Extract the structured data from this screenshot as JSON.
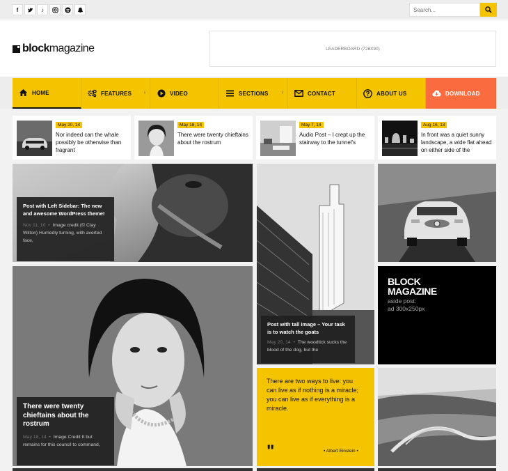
{
  "social": [
    "f",
    "t",
    "tk",
    "ig",
    "sp",
    "sc"
  ],
  "search": {
    "placeholder": "Search..."
  },
  "logo": {
    "bold": "block",
    "rest": "magazine"
  },
  "leaderboard": "LEADERBOARD (728X90)",
  "nav": [
    {
      "label": "HOME",
      "icon": "home-icon"
    },
    {
      "label": "FEATURES",
      "icon": "gears-icon"
    },
    {
      "label": "VIDEO",
      "icon": "play-icon"
    },
    {
      "label": "SECTIONS",
      "icon": "menu-icon"
    },
    {
      "label": "CONTACT",
      "icon": "envelope-icon"
    },
    {
      "label": "ABOUT US",
      "icon": "question-icon"
    },
    {
      "label": "DOWNLOAD",
      "icon": "cloud-download-icon"
    }
  ],
  "strip": [
    {
      "date": "May 20, 14",
      "title": "Nor indeed can the whale possibly be otherwise than fragrant"
    },
    {
      "date": "May 18, 14",
      "title": "There were twenty chieftains about the rostrum"
    },
    {
      "date": "May 7, 14",
      "title": "Audio Post – I crept up the stairway to the tunnel's"
    },
    {
      "date": "Aug 16, 13",
      "title": "In front was a quiet sunny landscape, a wide flat ahead on either side of the"
    }
  ],
  "posts": {
    "baboon": {
      "title": "Post with Left Sidebar: The new and awesome WordPress theme!",
      "date": "Nov 11, 10",
      "excerpt": "Image credit (© Clay Wilton) Hurriedly turning, with averted face,"
    },
    "tower": {
      "title": "Post with tall image – Your task is to watch the goats",
      "date": "May 20, 14",
      "excerpt": "The woodtick sucks the blood of the dog, but the"
    },
    "woman": {
      "title": "There were twenty chieftains about the rostrum",
      "date": "May 18, 14",
      "excerpt": "Image Credit It but remains for this council to command,"
    }
  },
  "quote": {
    "text": "There are two ways to live: you can live as if nothing is a miracle; you can live as if everything is a miracle.",
    "author": "Albert Einstein"
  },
  "ad": {
    "line1": "BLOCK",
    "line2": "MAGAZINE",
    "line3": "aside post:",
    "line4": "ad 300x250px"
  }
}
